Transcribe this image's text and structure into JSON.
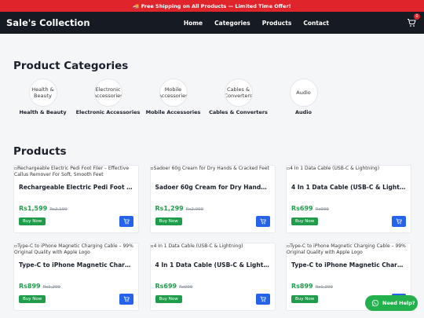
{
  "promo": {
    "text": "🚚 Free Shipping on All Products — Limited Time Offer!"
  },
  "header": {
    "brand": "Sale's Collection",
    "nav": [
      "Home",
      "Categories",
      "Products",
      "Contact"
    ],
    "cart_count": "0"
  },
  "categories": {
    "title": "Product Categories",
    "items": [
      {
        "image_alt": "Health & Beauty",
        "label": "Health & Beauty"
      },
      {
        "image_alt": "Electronic Accessories",
        "label": "Electronic Accessories"
      },
      {
        "image_alt": "Mobile Accessories",
        "label": "Mobile Accessories"
      },
      {
        "image_alt": "Cables & Converters",
        "label": "Cables & Converters"
      },
      {
        "image_alt": "Audio",
        "label": "Audio"
      }
    ]
  },
  "products": {
    "title": "Products",
    "buy_label": "Buy Now",
    "items": [
      {
        "image_alt": "Rechargeable Electric Pedi Foot Filer – Effective Callus Remover For Soft, Smooth Feet",
        "name": "Rechargeable Electric Pedi Foot Filer …",
        "price": "Rs1,599",
        "old_price": "Rs2,199"
      },
      {
        "image_alt": "Sadoer 60g Cream for Dry Hands & Cracked Feet",
        "name": "Sadoer 60g Cream for Dry Hands & C…",
        "price": "Rs1,299",
        "old_price": "Rs2,000"
      },
      {
        "image_alt": "4 In 1 Data Cable (USB-C & Lightning)",
        "name": "4 In 1 Data Cable (USB-C & Lightning)",
        "price": "Rs699",
        "old_price": "Rs999"
      },
      {
        "image_alt": "Type-C to iPhone Magnetic Charging Cable – 99% Original Quality with Apple Logo",
        "name": "Type-C to iPhone Magnetic Charging …",
        "price": "Rs899",
        "old_price": "Rs1,299"
      },
      {
        "image_alt": "4 In 1 Data Cable (USB-C & Lightning)",
        "name": "4 In 1 Data Cable (USB-C & Lightning)",
        "price": "Rs699",
        "old_price": "Rs999"
      },
      {
        "image_alt": "Type-C to iPhone Magnetic Charging Cable – 99% Original Quality with Apple Logo",
        "name": "Type-C to iPhone Magnetic Charging …",
        "price": "Rs899",
        "old_price": "Rs1,299"
      }
    ]
  },
  "whatsapp": {
    "label": "Need Help?"
  },
  "colors": {
    "promo": "#e0242c",
    "nav": "#151a23",
    "price": "#1f9d4a",
    "cart_button": "#2563eb",
    "whatsapp": "#22b14c"
  }
}
